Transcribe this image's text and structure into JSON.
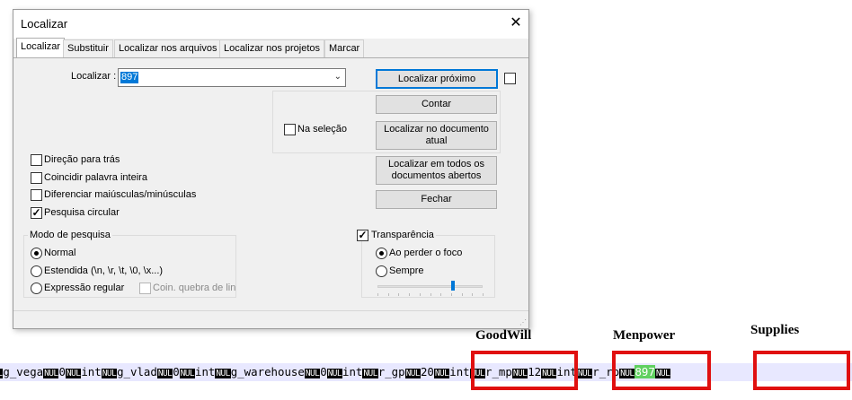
{
  "dialog": {
    "title": "Localizar",
    "close_symbol": "✕",
    "tabs": [
      {
        "label": "Localizar",
        "active": true
      },
      {
        "label": "Substituir",
        "active": false
      },
      {
        "label": "Localizar nos arquivos",
        "active": false
      },
      {
        "label": "Localizar nos projetos",
        "active": false
      },
      {
        "label": "Marcar",
        "active": false
      }
    ],
    "find_label": "Localizar :",
    "find_value": "897",
    "buttons": {
      "find_next": "Localizar próximo",
      "count": "Contar",
      "find_in_doc": "Localizar no documento atual",
      "find_in_all": "Localizar em todos os documentos abertos",
      "close": "Fechar"
    },
    "in_selection": {
      "label": "Na seleção",
      "checked": false
    },
    "options": [
      {
        "label": "Direção para trás",
        "checked": false
      },
      {
        "label": "Coincidir palavra inteira",
        "checked": false
      },
      {
        "label": "Diferenciar maiúsculas/minúsculas",
        "checked": false
      },
      {
        "label": "Pesquisa circular",
        "checked": true
      }
    ],
    "search_mode": {
      "title": "Modo de pesquisa",
      "normal": "Normal",
      "extended": "Estendida  (\\n, \\r, \\t, \\0, \\x...)",
      "regex": "Expressão regular",
      "dot_newline": "Coin. quebra de lin",
      "selected": "Normal"
    },
    "transparency": {
      "label": "Transparência",
      "checked": true,
      "on_lose_focus": "Ao perder o foco",
      "always": "Sempre",
      "selected": "Ao perder o foco",
      "slider_level": 0.72
    }
  },
  "annotations": {
    "goodwill": "GoodWill",
    "manpower": "Menpower",
    "supplies": "Supplies"
  },
  "hex_line": {
    "nul_token": "NUL",
    "parts": [
      "",
      "NUL",
      "g_vega",
      "NUL",
      "0",
      "NUL",
      "int",
      "NUL",
      "g_vlad",
      "NUL",
      "0",
      "NUL",
      "int",
      "NUL",
      "g_warehouse",
      "NUL",
      "0",
      "NUL",
      "int",
      "NUL",
      "r_gp",
      "NUL",
      "20",
      "NUL",
      "int",
      "NUL",
      "r_mp",
      "NUL",
      "12",
      "NUL",
      "int",
      "NUL",
      "r_rp",
      "NUL",
      "897",
      "NUL"
    ],
    "highlight": "897"
  },
  "colors": {
    "accent": "#0078d7",
    "annotation_box": "#e01010",
    "match_highlight": "#60d060"
  }
}
